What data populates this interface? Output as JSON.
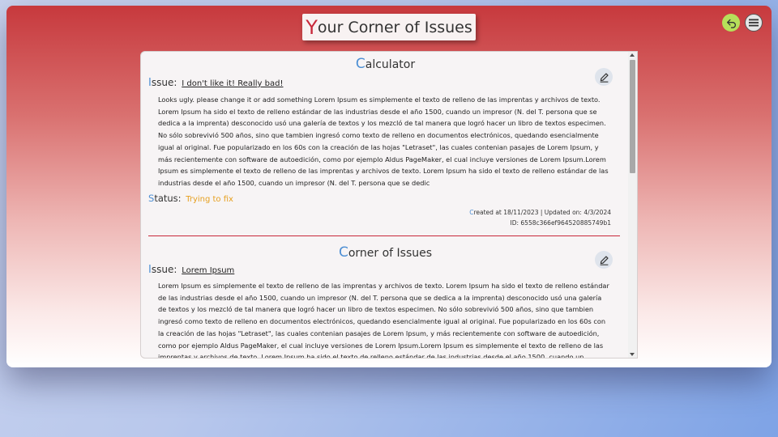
{
  "app": {
    "title_first": "Y",
    "title_rest": "our Corner of Issues"
  },
  "icons": {
    "back": "return-arrow-icon",
    "menu": "hamburger-menu-icon",
    "edit": "pencil-edit-icon"
  },
  "colors": {
    "accent_red": "#c8283a",
    "accent_blue": "#4d8fd4",
    "status_yellow": "#e6a020",
    "back_button": "#b6e05a"
  },
  "issues": [
    {
      "title_first": "C",
      "title_rest": "alculator",
      "issue_label_first": "I",
      "issue_label_rest": "ssue:",
      "issue_name": "I don't like it! Really bad!",
      "description": "Looks ugly. please change it or add something Lorem Ipsum es simplemente el texto de relleno de las imprentas y archivos de texto. Lorem Ipsum ha sido el texto de relleno estándar de las industrias desde el año 1500, cuando un impresor (N. del T. persona que se dedica a la imprenta) desconocido usó una galería de textos y los mezcló de tal manera que logró hacer un libro de textos especimen. No sólo sobrevivió 500 años, sino que tambien ingresó como texto de relleno en documentos electrónicos, quedando esencialmente igual al original. Fue popularizado en los 60s con la creación de las hojas \"Letraset\", las cuales contenian pasajes de Lorem Ipsum, y más recientemente con software de autoedición, como por ejemplo Aldus PageMaker, el cual incluye versiones de Lorem Ipsum.Lorem Ipsum es simplemente el texto de relleno de las imprentas y archivos de texto. Lorem Ipsum ha sido el texto de relleno estándar de las industrias desde el año 1500, cuando un impresor (N. del T. persona que se dedic",
      "status_label_first": "S",
      "status_label_rest": "tatus:",
      "status": "Trying to fix",
      "dates_first": "C",
      "dates_rest": "reated at 18/11/2023 | Updated on: 4/3/2024",
      "id": "ID: 6558c366ef964520885749b1"
    },
    {
      "title_first": "C",
      "title_rest": "orner of Issues",
      "issue_label_first": "I",
      "issue_label_rest": "ssue:",
      "issue_name": "Lorem Ipsum",
      "description": "Lorem Ipsum es simplemente el texto de relleno de las imprentas y archivos de texto. Lorem Ipsum ha sido el texto de relleno estándar de las industrias desde el año 1500, cuando un impresor (N. del T. persona que se dedica a la imprenta) desconocido usó una galería de textos y los mezcló de tal manera que logró hacer un libro de textos especimen. No sólo sobrevivió 500 años, sino que tambien ingresó como texto de relleno en documentos electrónicos, quedando esencialmente igual al original. Fue popularizado en los 60s con la creación de las hojas \"Letraset\", las cuales contenian pasajes de Lorem Ipsum, y más recientemente con software de autoedición, como por ejemplo Aldus PageMaker, el cual incluye versiones de Lorem Ipsum.Lorem Ipsum es simplemente el texto de relleno de las imprentas y archivos de texto. Lorem Ipsum ha sido el texto de relleno estándar de las industrias desde el año 1500, cuando un impresor (N. del T. persona que se dedic"
    }
  ]
}
